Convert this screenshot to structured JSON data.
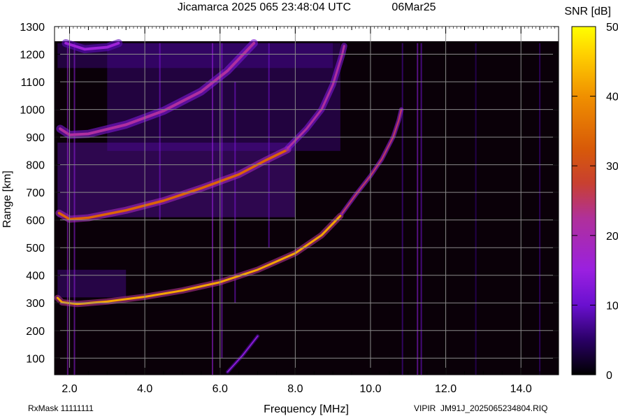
{
  "header": {
    "title": "Jicamarca 2025 065 23:48:04 UTC",
    "date": "06Mar25"
  },
  "footer": {
    "rxmask": "RxMask 11111111",
    "file": "VIPIR  JM91J_2025065234804.RIQ"
  },
  "chart_data": {
    "type": "heatmap",
    "title": "Jicamarca 2025 065 23:48:04 UTC",
    "xlabel": "Frequency [MHz]",
    "ylabel": "Range [km]",
    "xlim": [
      1.6,
      15.0
    ],
    "ylim": [
      40,
      1300
    ],
    "data_range_ylim": [
      40,
      1240
    ],
    "x_ticks": [
      2.0,
      4.0,
      6.0,
      8.0,
      10.0,
      12.0,
      14.0
    ],
    "x_tick_labels": [
      "2.0",
      "4.0",
      "6.0",
      "8.0",
      "10.0",
      "12.0",
      "14.0"
    ],
    "y_ticks": [
      100,
      200,
      300,
      400,
      500,
      600,
      700,
      800,
      900,
      1000,
      1100,
      1200,
      1300
    ],
    "y_tick_labels": [
      "100",
      "200",
      "300",
      "400",
      "500",
      "600",
      "700",
      "800",
      "900",
      "1000",
      "1100",
      "1200",
      "1300"
    ],
    "grid": true,
    "colorbar": {
      "label": "SNR [dB]",
      "min": 0,
      "max": 50,
      "ticks": [
        0,
        10,
        20,
        30,
        40,
        50
      ],
      "tick_labels": [
        "0",
        "10",
        "20",
        "30",
        "40",
        "50"
      ],
      "colormap": "gnuplot",
      "colors": [
        "#000000",
        "#2a0066",
        "#7a12d9",
        "#9a2ae0",
        "#b83f9a",
        "#d75410",
        "#f0a000",
        "#ffff00"
      ]
    },
    "background_color": "#0a0008",
    "traces": [
      {
        "name": "",
        "points": [
          [
            1.68,
            318
          ],
          [
            1.8,
            302
          ],
          [
            2.2,
            296
          ],
          [
            3.0,
            305
          ],
          [
            4.0,
            322
          ],
          [
            5.0,
            345
          ],
          [
            6.0,
            375
          ],
          [
            7.0,
            420
          ],
          [
            8.0,
            480
          ],
          [
            8.7,
            545
          ],
          [
            9.2,
            615
          ]
        ],
        "peak_snr_db": 42,
        "spread_km": 14
      },
      {
        "name": "",
        "points": [
          [
            9.25,
            625
          ],
          [
            9.6,
            690
          ],
          [
            10.0,
            760
          ],
          [
            10.3,
            820
          ],
          [
            10.6,
            900
          ],
          [
            10.75,
            960
          ],
          [
            10.82,
            1000
          ]
        ],
        "peak_snr_db": 25,
        "spread_km": 10
      },
      {
        "name": "",
        "points": [
          [
            1.72,
            625
          ],
          [
            2.0,
            603
          ],
          [
            2.5,
            608
          ],
          [
            3.5,
            635
          ],
          [
            4.5,
            670
          ],
          [
            5.5,
            715
          ],
          [
            6.5,
            765
          ],
          [
            7.2,
            815
          ],
          [
            7.8,
            855
          ]
        ],
        "peak_snr_db": 34,
        "spread_km": 16
      },
      {
        "name": "",
        "points": [
          [
            7.8,
            860
          ],
          [
            8.3,
            930
          ],
          [
            8.7,
            1000
          ],
          [
            9.0,
            1090
          ],
          [
            9.25,
            1200
          ],
          [
            9.3,
            1230
          ]
        ],
        "peak_snr_db": 22,
        "spread_km": 14
      },
      {
        "name": "",
        "points": [
          [
            1.75,
            930
          ],
          [
            2.0,
            908
          ],
          [
            2.5,
            912
          ],
          [
            3.5,
            945
          ],
          [
            4.5,
            995
          ],
          [
            5.5,
            1065
          ],
          [
            6.2,
            1140
          ],
          [
            6.9,
            1240
          ]
        ],
        "peak_snr_db": 22,
        "spread_km": 18
      },
      {
        "name": "",
        "points": [
          [
            1.9,
            1240
          ],
          [
            2.4,
            1218
          ],
          [
            3.0,
            1225
          ],
          [
            3.3,
            1240
          ]
        ],
        "peak_snr_db": 16,
        "spread_km": 18
      },
      {
        "name": "",
        "points": [
          [
            6.2,
            50
          ],
          [
            6.6,
            110
          ],
          [
            7.0,
            180
          ]
        ],
        "peak_snr_db": 14,
        "spread_km": 8
      }
    ],
    "diffuse_regions": [
      {
        "f_range": [
          1.68,
          8.0
        ],
        "r_range": [
          610,
          880
        ],
        "snr_db": 11
      },
      {
        "f_range": [
          3.0,
          9.2
        ],
        "r_range": [
          850,
          1240
        ],
        "snr_db": 8
      },
      {
        "f_range": [
          1.68,
          3.5
        ],
        "r_range": [
          320,
          420
        ],
        "snr_db": 9
      },
      {
        "f_range": [
          1.68,
          9.0
        ],
        "r_range": [
          1150,
          1240
        ],
        "snr_db": 8
      }
    ],
    "vertical_streaks": [
      {
        "f": 1.95,
        "r_range": [
          40,
          1240
        ],
        "snr_db": 16
      },
      {
        "f": 2.13,
        "r_range": [
          40,
          1240
        ],
        "snr_db": 14
      },
      {
        "f": 4.4,
        "r_range": [
          600,
          1240
        ],
        "snr_db": 12
      },
      {
        "f": 5.8,
        "r_range": [
          40,
          1240
        ],
        "snr_db": 15
      },
      {
        "f": 6.05,
        "r_range": [
          100,
          1240
        ],
        "snr_db": 13
      },
      {
        "f": 6.4,
        "r_range": [
          300,
          1100
        ],
        "snr_db": 12
      },
      {
        "f": 7.3,
        "r_range": [
          500,
          1240
        ],
        "snr_db": 11
      },
      {
        "f": 10.85,
        "r_range": [
          40,
          1240
        ],
        "snr_db": 8
      },
      {
        "f": 11.25,
        "r_range": [
          40,
          1240
        ],
        "snr_db": 14
      },
      {
        "f": 11.35,
        "r_range": [
          40,
          1240
        ],
        "snr_db": 11
      },
      {
        "f": 12.8,
        "r_range": [
          40,
          1240
        ],
        "snr_db": 6
      },
      {
        "f": 14.5,
        "r_range": [
          40,
          1240
        ],
        "snr_db": 7
      }
    ]
  }
}
